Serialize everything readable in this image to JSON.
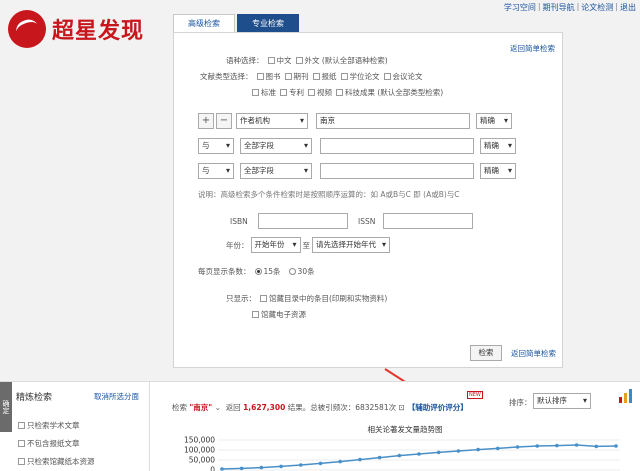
{
  "header": {
    "logo_text": "超星发现",
    "links": [
      "学习空间",
      "期刊导航",
      "论文检测",
      "退出"
    ]
  },
  "tabs": [
    "高级检索",
    "专业检索"
  ],
  "panel": {
    "back_simple": "返回简单检索",
    "lang_label": "语种选择：",
    "lang_options": [
      "中文",
      "外文 (默认全部语种检索)"
    ],
    "doc_label": "文献类型选择：",
    "doc_options_row1": [
      "图书",
      "期刊",
      "报纸",
      "学位论文",
      "会议论文"
    ],
    "doc_options_row2": [
      "标准",
      "专利",
      "视频",
      "科技成果 (默认全部类型检索)"
    ],
    "rows": [
      {
        "logic": "",
        "field": "作者机构",
        "value": "南京",
        "match": "精确"
      },
      {
        "logic": "与",
        "field": "全部字段",
        "value": "",
        "match": "精确"
      },
      {
        "logic": "与",
        "field": "全部字段",
        "value": "",
        "match": "精确"
      }
    ],
    "plus": "+",
    "minus": "−",
    "note": "说明：高级检索多个条件检索时是按照顺序运算的：如 A或B与C 即 (A或B)与C",
    "isbn_label": "ISBN",
    "issn_label": "ISSN",
    "year_label": "年份：",
    "year_start": "开始年份",
    "year_to": "至",
    "year_end": "请先选择开始年代",
    "perpage_label": "每页显示条数：",
    "perpage_options": [
      "15条",
      "30条"
    ],
    "only_label": "只显示：",
    "only_options": [
      "馆藏目录中的条目(印刷和实物资料)",
      "馆藏电子资源"
    ],
    "search_btn": "检索",
    "back_simple_2": "返回简单检索"
  },
  "refine": {
    "side_tab": "确定",
    "title": "精炼检索",
    "cancel": "取消所选分面",
    "items": [
      "只检索学术文章",
      "不包含报纸文章",
      "只检索馆藏纸本资源"
    ]
  },
  "results": {
    "prefix": "检索",
    "keyword": "\"南京\"",
    "found": "返回",
    "count": "1,627,300",
    "count_suffix": "结果。总被引频次：6832581次",
    "assist": "【辅助评价评分】",
    "new": "NEW",
    "sort_label": "排序：",
    "sort_value": "默认排序",
    "viz_label": "可视化"
  },
  "chart_data": {
    "type": "line",
    "title": "相关论著发文量趋势图",
    "ylim": [
      0,
      150000
    ],
    "yticks": [
      "150,000",
      "100,000",
      "50,000",
      "0"
    ],
    "values": [
      5000,
      8000,
      12000,
      18000,
      25000,
      33000,
      42000,
      52000,
      62000,
      72000,
      80000,
      88000,
      95000,
      102000,
      108000,
      115000,
      120000,
      122000,
      125000,
      118000,
      120000
    ],
    "color": "#4a90c8",
    "gridline_color": "#dddddd"
  },
  "colors": {
    "brand": "#c8161d",
    "link": "#1a55a0",
    "tab_active_bg": "#1f4e8c",
    "arrow": "#e5322d"
  }
}
